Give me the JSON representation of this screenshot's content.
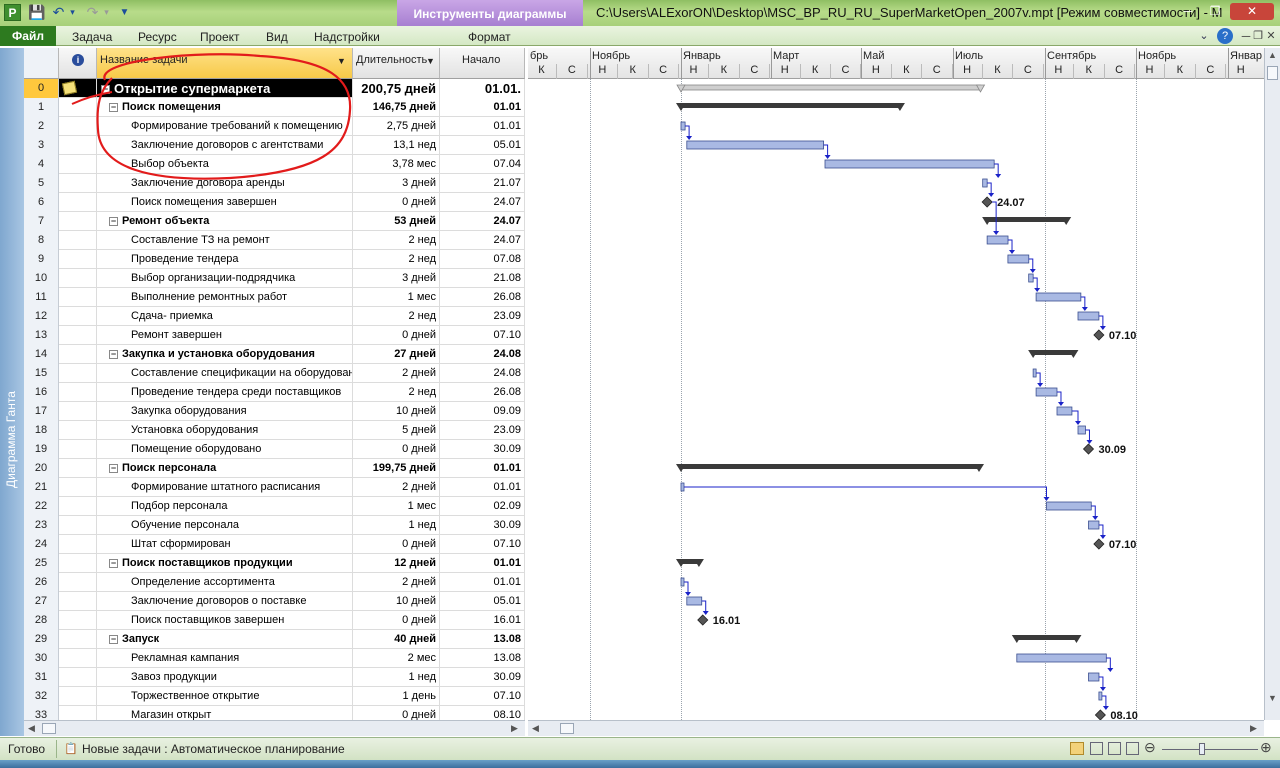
{
  "window": {
    "title": "C:\\Users\\ALExorON\\Desktop\\MSC_BP_RU_RU_SuperMarketOpen_2007v.mpt [Режим совместимости] - M",
    "context_tab": "Инструменты диаграммы Ганта",
    "app_icon": "P"
  },
  "ribbon": {
    "file": "Файл",
    "tabs": [
      "Задача",
      "Ресурс",
      "Проект",
      "Вид",
      "Надстройки"
    ],
    "format": "Формат"
  },
  "sidebar": {
    "label": "Диаграмма Ганта"
  },
  "table": {
    "columns": {
      "info_icon": "i",
      "name": "Название задачи",
      "duration": "Длительность",
      "start": "Начало"
    },
    "rows": [
      {
        "id": "0",
        "name": "Открытие супермаркета",
        "duration": "200,75 дней",
        "start": "01.01.",
        "level": 0,
        "summary": true,
        "note": true
      },
      {
        "id": "1",
        "name": "Поиск помещения",
        "duration": "146,75 дней",
        "start": "01.01",
        "level": 1,
        "summary": true
      },
      {
        "id": "2",
        "name": "Формирование требований к помещению",
        "duration": "2,75 дней",
        "start": "01.01",
        "level": 2
      },
      {
        "id": "3",
        "name": "Заключение договоров с агентствами",
        "duration": "13,1 нед",
        "start": "05.01",
        "level": 2
      },
      {
        "id": "4",
        "name": "Выбор объекта",
        "duration": "3,78 мес",
        "start": "07.04",
        "level": 2
      },
      {
        "id": "5",
        "name": "Заключение договора аренды",
        "duration": "3 дней",
        "start": "21.07",
        "level": 2
      },
      {
        "id": "6",
        "name": "Поиск помещения завершен",
        "duration": "0 дней",
        "start": "24.07",
        "level": 2
      },
      {
        "id": "7",
        "name": "Ремонт объекта",
        "duration": "53 дней",
        "start": "24.07",
        "level": 1,
        "summary": true
      },
      {
        "id": "8",
        "name": "Составление ТЗ на ремонт",
        "duration": "2 нед",
        "start": "24.07",
        "level": 2
      },
      {
        "id": "9",
        "name": "Проведение тендера",
        "duration": "2 нед",
        "start": "07.08",
        "level": 2
      },
      {
        "id": "10",
        "name": "Выбор организации-подрядчика",
        "duration": "3 дней",
        "start": "21.08",
        "level": 2
      },
      {
        "id": "11",
        "name": "Выполнение ремонтных работ",
        "duration": "1 мес",
        "start": "26.08",
        "level": 2
      },
      {
        "id": "12",
        "name": "Сдача- приемка",
        "duration": "2 нед",
        "start": "23.09",
        "level": 2
      },
      {
        "id": "13",
        "name": "Ремонт завершен",
        "duration": "0 дней",
        "start": "07.10",
        "level": 2
      },
      {
        "id": "14",
        "name": "Закупка и установка оборудования",
        "duration": "27 дней",
        "start": "24.08",
        "level": 1,
        "summary": true
      },
      {
        "id": "15",
        "name": "Составление спецификации на оборудование",
        "duration": "2 дней",
        "start": "24.08",
        "level": 2
      },
      {
        "id": "16",
        "name": "Проведение тендера среди поставщиков",
        "duration": "2 нед",
        "start": "26.08",
        "level": 2
      },
      {
        "id": "17",
        "name": "Закупка оборудования",
        "duration": "10 дней",
        "start": "09.09",
        "level": 2
      },
      {
        "id": "18",
        "name": "Установка оборудования",
        "duration": "5 дней",
        "start": "23.09",
        "level": 2
      },
      {
        "id": "19",
        "name": "Помещение оборудовано",
        "duration": "0 дней",
        "start": "30.09",
        "level": 2
      },
      {
        "id": "20",
        "name": "Поиск персонала",
        "duration": "199,75 дней",
        "start": "01.01",
        "level": 1,
        "summary": true
      },
      {
        "id": "21",
        "name": "Формирование штатного расписания",
        "duration": "2 дней",
        "start": "01.01",
        "level": 2
      },
      {
        "id": "22",
        "name": "Подбор персонала",
        "duration": "1 мес",
        "start": "02.09",
        "level": 2
      },
      {
        "id": "23",
        "name": "Обучение персонала",
        "duration": "1 нед",
        "start": "30.09",
        "level": 2
      },
      {
        "id": "24",
        "name": "Штат сформирован",
        "duration": "0 дней",
        "start": "07.10",
        "level": 2
      },
      {
        "id": "25",
        "name": "Поиск поставщиков продукции",
        "duration": "12 дней",
        "start": "01.01",
        "level": 1,
        "summary": true
      },
      {
        "id": "26",
        "name": "Определение ассортимента",
        "duration": "2 дней",
        "start": "01.01",
        "level": 2
      },
      {
        "id": "27",
        "name": "Заключение договоров о поставке",
        "duration": "10 дней",
        "start": "05.01",
        "level": 2
      },
      {
        "id": "28",
        "name": "Поиск поставщиков завершен",
        "duration": "0 дней",
        "start": "16.01",
        "level": 2
      },
      {
        "id": "29",
        "name": "Запуск",
        "duration": "40 дней",
        "start": "13.08",
        "level": 1,
        "summary": true
      },
      {
        "id": "30",
        "name": "Рекламная кампания",
        "duration": "2 мес",
        "start": "13.08",
        "level": 2
      },
      {
        "id": "31",
        "name": "Завоз продукции",
        "duration": "1 нед",
        "start": "30.09",
        "level": 2
      },
      {
        "id": "32",
        "name": "Торжественное открытие",
        "duration": "1 день",
        "start": "07.10",
        "level": 2
      },
      {
        "id": "33",
        "name": "Магазин открыт",
        "duration": "0 дней",
        "start": "08.10",
        "level": 2
      }
    ]
  },
  "timescale": {
    "months": [
      "брь",
      "Ноябрь",
      "Январь",
      "Март",
      "Май",
      "Июль",
      "Сентябрь",
      "Ноябрь",
      "Январ"
    ],
    "thirds": [
      "К",
      "С",
      "Н",
      "К",
      "С",
      "Н",
      "К",
      "С",
      "Н",
      "К",
      "С",
      "Н",
      "К",
      "С",
      "Н",
      "К",
      "С",
      "Н",
      "К",
      "С",
      "Н",
      "К",
      "С",
      "Н"
    ]
  },
  "gantt": {
    "milestone_labels": {
      "6": "24.07",
      "13": "07.10",
      "19": "30.09",
      "24": "07.10",
      "28": "16.01",
      "33": "08.10"
    }
  },
  "status": {
    "ready": "Готово",
    "new_tasks": "Новые задачи : Автоматическое планирование"
  },
  "colors": {
    "ribbon_green": "#2d7a1f",
    "context_purple": "#a77fd1",
    "task_bar": "#a9b9e3",
    "link_arrow": "#1a22c8",
    "annotation_red": "#e21b1b",
    "selected_row": "#000000",
    "id_highlight": "#ffc83d"
  }
}
